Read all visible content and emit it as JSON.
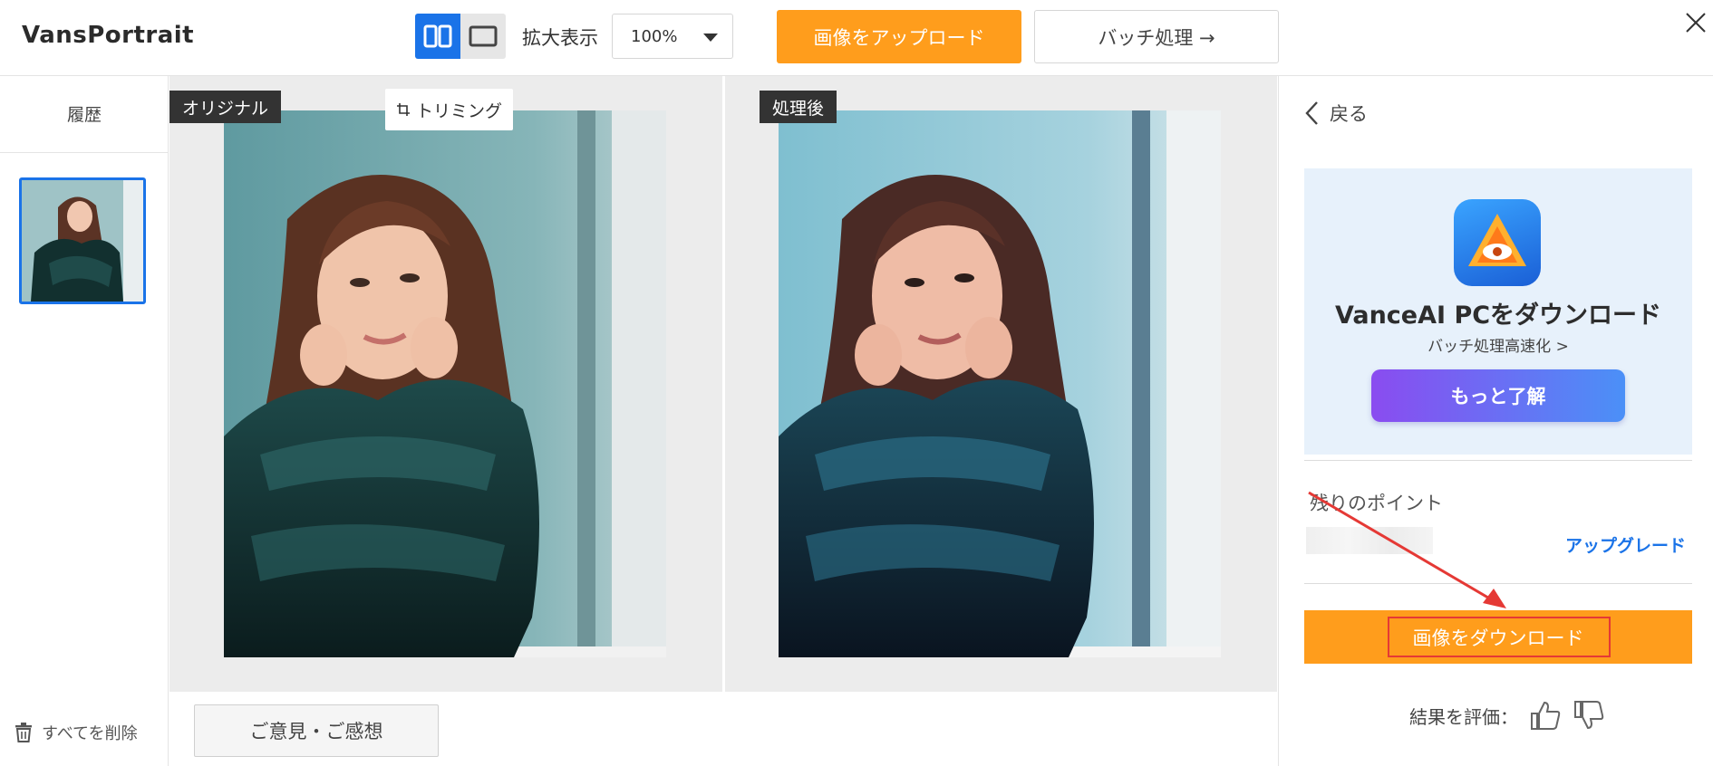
{
  "app": {
    "logo": "VansPortrait"
  },
  "toolbar": {
    "zoom_label": "拡大表示",
    "zoom_value": "100%",
    "upload_label": "画像をアップロード",
    "batch_label": "バッチ処理 →"
  },
  "sidebar": {
    "history_title": "履歴",
    "delete_all_label": "すべてを削除"
  },
  "compare": {
    "original_tag": "オリジナル",
    "trim_label": "トリミング",
    "processed_tag": "処理後",
    "feedback_label": "ご意見・ご感想"
  },
  "right_panel": {
    "back_label": "戻る",
    "promo": {
      "title": "VanceAI PCをダウンロード",
      "subtitle": "バッチ処理高速化 >",
      "button_label": "もっと了解"
    },
    "points_label": "残りのポイント",
    "upgrade_label": "アップグレード",
    "download_label": "画像をダウンロード",
    "rate_label": "結果を評価："
  },
  "colors": {
    "accent_blue": "#1a73e8",
    "accent_orange": "#ff9d1c",
    "annotation_red": "#e53935"
  }
}
